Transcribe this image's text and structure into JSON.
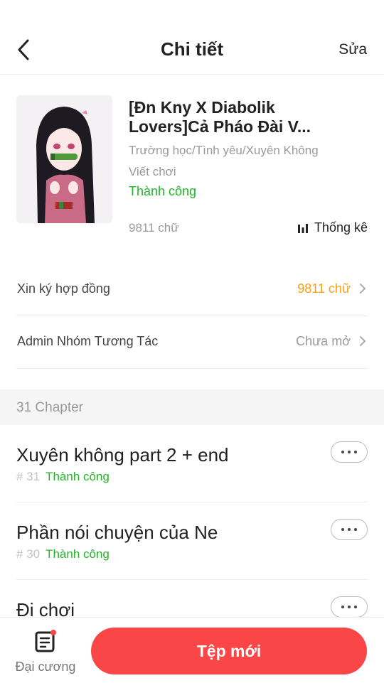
{
  "header": {
    "title": "Chi tiết",
    "edit_label": "Sửa"
  },
  "book": {
    "title": "[Đn Kny X Diabolik\nLovers]Cả Pháo Đài V...",
    "genres": "Trường học/Tình yêu/Xuyên Không",
    "type": "Viết chơi",
    "status": "Thành công",
    "word_count": "9811 chữ",
    "stats_label": "Thống kê"
  },
  "settings": [
    {
      "label": "Xin ký hợp đồng",
      "value": "9811 chữ",
      "value_color": "#f5a11c"
    },
    {
      "label": "Admin Nhóm Tương Tác",
      "value": "Chưa mở",
      "value_color": "#999999"
    }
  ],
  "chapters_header": "31 Chapter",
  "chapters": [
    {
      "title": "Xuyên không part 2 + end",
      "number": "# 31",
      "status": "Thành công"
    },
    {
      "title": "Phần nói chuyện của Ne",
      "number": "# 30",
      "status": "Thành công"
    },
    {
      "title": "Đi chơi",
      "number": "",
      "status": ""
    }
  ],
  "bottom": {
    "outline_label": "Đại cương",
    "new_button_label": "Tệp mới"
  },
  "colors": {
    "accent": "#fa4646",
    "success": "#22b526",
    "warning": "#f5a11c"
  }
}
